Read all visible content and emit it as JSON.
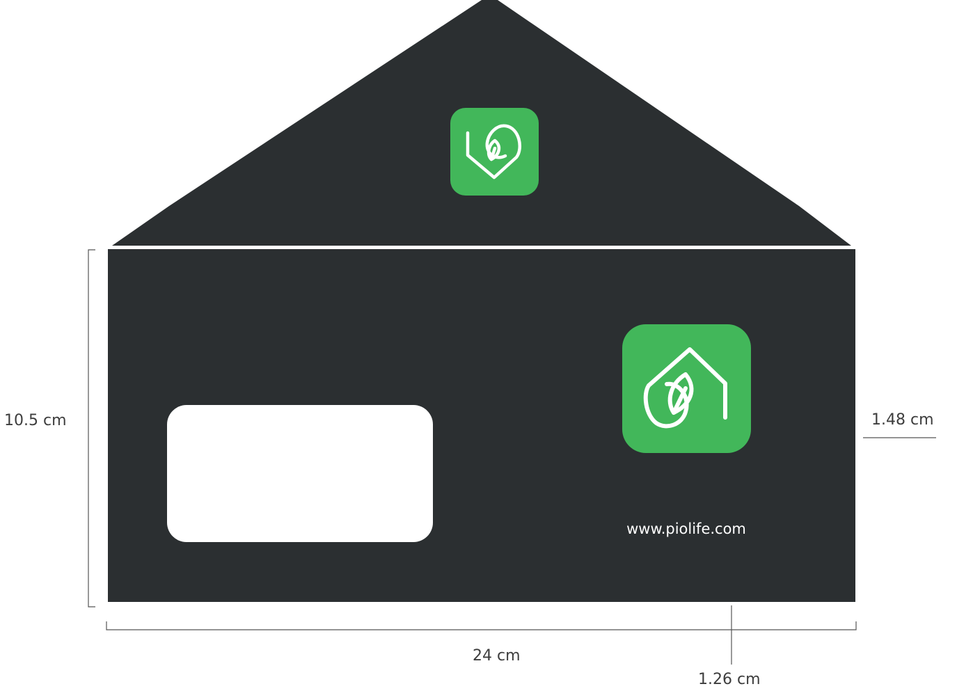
{
  "colors": {
    "envelope": "#2b2f31",
    "brand_green": "#42b75a",
    "icon_stroke": "#ffffff",
    "window": "#ffffff",
    "dimension_line": "#555555",
    "label_text": "#3d3d3d"
  },
  "envelope": {
    "website": "www.piolife.com",
    "flap_logo_icon": "leaf-heart-icon",
    "body_logo_icon": "house-leaf-icon"
  },
  "dimensions": {
    "height": "10.5 cm",
    "width": "24 cm",
    "right_margin": "1.48 cm",
    "bottom_offset": "1.26 cm"
  }
}
